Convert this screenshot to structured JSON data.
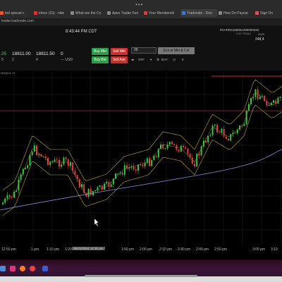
{
  "browser": {
    "menu_dots": "•••",
    "tabs": [
      {
        "label": "ted spread c"
      },
      {
        "label": "Inbox (15) - nike"
      },
      {
        "label": "What are the Co"
      },
      {
        "label": "Apex Trader Fun"
      },
      {
        "label": "Your Membershi"
      },
      {
        "label": "Tradovate - Des"
      },
      {
        "label": "How Do Payout"
      },
      {
        "label": "Sign On"
      }
    ],
    "url": "trader.tradovate.com"
  },
  "panel": {
    "clock": "8:43:44 PM CDT",
    "symbol": "PAAPEX169001290000232",
    "symbol_sub": "LIVE TRDNG",
    "account_label": "Acct",
    "account_value": "248,4",
    "left_value": ".25",
    "left_sub": "5",
    "bid": "18811.00",
    "bid_sub": "2",
    "ask": "18811.50",
    "ask_sub": "4",
    "position": "0",
    "position_sub": "--- USD",
    "buy_mkt": "Buy Mkt",
    "sell_mkt": "Sell Mkt",
    "buy_bid": "Buy Bid",
    "sell_ask": "Sell Ask",
    "qty": "20",
    "exit_all": "Exit at Mkt & Cxl",
    "off": "OFF",
    "day": "DAY",
    "zero": "0"
  },
  "chart": {
    "label": "MNQM4 1T",
    "time_labels": [
      "12:50 pm",
      "1 pm",
      "1:10 pm",
      "1:20",
      "1:50 pm",
      "2:00 pm",
      "2:10 pm",
      "2:30 pm",
      "2:40 pm",
      "2:50 pm",
      "3:00 pm",
      "3:10"
    ],
    "hover_date": "05/31/2024 12:30 pm",
    "colors": {
      "up": "#2ecc40",
      "down": "#e63b3b",
      "band": "#c8a92a",
      "ma": "#8a8ad8"
    }
  },
  "taskbar": {
    "icons": [
      "finder-icon",
      "app-icon",
      "firefox-icon",
      "chrome-icon",
      "tradovate-icon"
    ]
  }
}
